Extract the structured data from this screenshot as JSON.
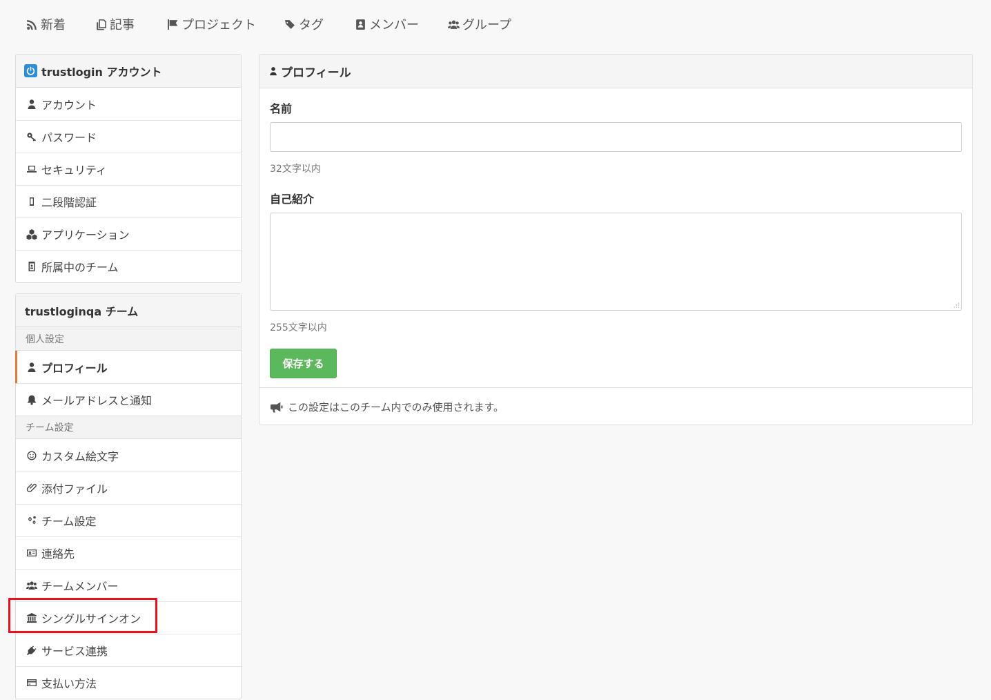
{
  "topnav": {
    "items": [
      {
        "label": "新着",
        "icon": "rss-icon"
      },
      {
        "label": "記事",
        "icon": "article-icon"
      },
      {
        "label": "プロジェクト",
        "icon": "flag-icon"
      },
      {
        "label": "タグ",
        "icon": "tags-icon"
      },
      {
        "label": "メンバー",
        "icon": "contact-book-icon"
      },
      {
        "label": "グループ",
        "icon": "users-icon"
      }
    ]
  },
  "sidebar": {
    "account_panel": {
      "title": "trustlogin アカウント",
      "items": [
        {
          "label": "アカウント",
          "icon": "user-icon"
        },
        {
          "label": "パスワード",
          "icon": "key-icon"
        },
        {
          "label": "セキュリティ",
          "icon": "laptop-icon"
        },
        {
          "label": "二段階認証",
          "icon": "mobile-icon"
        },
        {
          "label": "アプリケーション",
          "icon": "cubes-icon"
        },
        {
          "label": "所属中のチーム",
          "icon": "id-badge-icon"
        }
      ]
    },
    "team_panel": {
      "title": "trustloginqa チーム",
      "personal_section": "個人設定",
      "personal_items": [
        {
          "label": "プロフィール",
          "icon": "user-icon",
          "active": true
        },
        {
          "label": "メールアドレスと通知",
          "icon": "bell-icon"
        }
      ],
      "team_section": "チーム設定",
      "team_items": [
        {
          "label": "カスタム絵文字",
          "icon": "smile-icon"
        },
        {
          "label": "添付ファイル",
          "icon": "paperclip-icon"
        },
        {
          "label": "チーム設定",
          "icon": "cogs-icon"
        },
        {
          "label": "連絡先",
          "icon": "address-card-icon"
        },
        {
          "label": "チームメンバー",
          "icon": "users-icon"
        },
        {
          "label": "シングルサインオン",
          "icon": "bank-icon"
        },
        {
          "label": "サービス連携",
          "icon": "plug-icon"
        },
        {
          "label": "支払い方法",
          "icon": "credit-card-icon"
        }
      ]
    }
  },
  "main": {
    "title": "プロフィール",
    "name_label": "名前",
    "name_value": "",
    "name_help": "32文字以内",
    "bio_label": "自己紹介",
    "bio_value": "",
    "bio_help": "255文字以内",
    "save_label": "保存する",
    "footer_note": "この設定はこのチーム内でのみ使用されます。"
  },
  "colors": {
    "accent_active": "#e07b39",
    "save_button": "#5cb85c",
    "highlight": "#e8101c",
    "logo": "#2a8fd6"
  }
}
